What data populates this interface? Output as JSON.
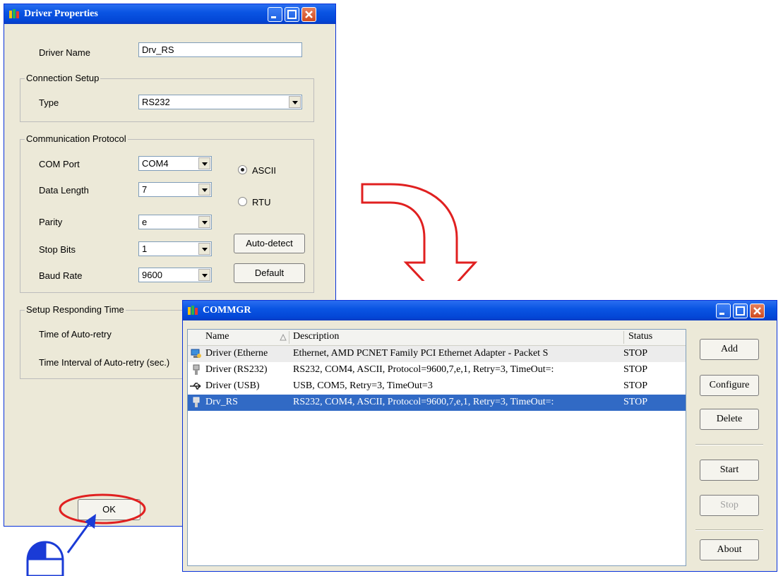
{
  "driver_props": {
    "title": "Driver Properties",
    "driver_name_label": "Driver Name",
    "driver_name_value": "Drv_RS",
    "connection_setup": "Connection Setup",
    "type_label": "Type",
    "type_value": "RS232",
    "protocol_group": "Communication Protocol",
    "com_port_label": "COM Port",
    "com_port_value": "COM4",
    "data_length_label": "Data Length",
    "data_length_value": "7",
    "parity_label": "Parity",
    "parity_value": "e",
    "stop_bits_label": "Stop Bits",
    "stop_bits_value": "1",
    "baud_rate_label": "Baud Rate",
    "baud_rate_value": "9600",
    "ascii_label": "ASCII",
    "rtu_label": "RTU",
    "auto_detect_label": "Auto-detect",
    "default_label": "Default",
    "responding_group": "Setup Responding Time",
    "auto_retry_label": "Time of Auto-retry",
    "auto_retry_interval_label": "Time Interval of Auto-retry (sec.)",
    "ok_label": "OK"
  },
  "commgr": {
    "title": "COMMGR",
    "columns": {
      "name": "Name",
      "description": "Description",
      "status": "Status"
    },
    "rows": [
      {
        "name": "Driver (Etherne",
        "description": "Ethernet, AMD PCNET Family PCI Ethernet Adapter - Packet S",
        "status": "STOP",
        "icon": "network-icon"
      },
      {
        "name": "Driver (RS232)",
        "description": "RS232, COM4, ASCII, Protocol=9600,7,e,1, Retry=3, TimeOut=:",
        "status": "STOP",
        "icon": "serial-port-icon"
      },
      {
        "name": "Driver (USB)",
        "description": "USB, COM5, Retry=3, TimeOut=3",
        "status": "STOP",
        "icon": "usb-icon"
      },
      {
        "name": "Drv_RS",
        "description": "RS232, COM4, ASCII, Protocol=9600,7,e,1, Retry=3, TimeOut=:",
        "status": "STOP",
        "icon": "serial-port-icon"
      }
    ],
    "buttons": {
      "add": "Add",
      "configure": "Configure",
      "delete": "Delete",
      "start": "Start",
      "stop": "Stop",
      "about": "About"
    }
  },
  "colors": {
    "highlight_ellipse": "#e02020",
    "flow_arrow": "#e02020",
    "pointer_arrow": "#1a3bd6",
    "selected_row": "#316ac5"
  }
}
